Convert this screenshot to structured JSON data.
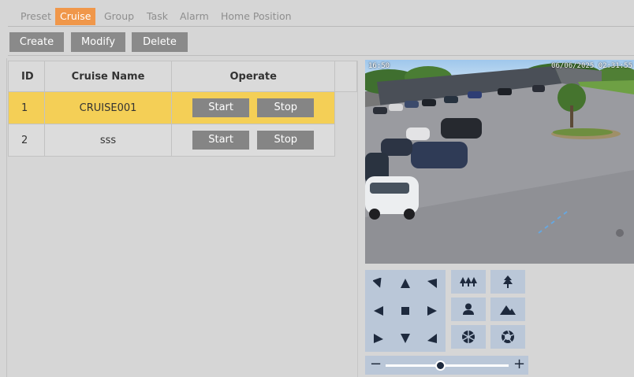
{
  "tabs": [
    {
      "label": "Preset",
      "active": false
    },
    {
      "label": "Cruise",
      "active": true
    },
    {
      "label": "Group",
      "active": false
    },
    {
      "label": "Task",
      "active": false
    },
    {
      "label": "Alarm",
      "active": false
    },
    {
      "label": "Home Position",
      "active": false
    }
  ],
  "toolbar": {
    "create_label": "Create",
    "modify_label": "Modify",
    "delete_label": "Delete"
  },
  "table": {
    "headers": [
      "ID",
      "Cruise Name",
      "Operate"
    ],
    "rows": [
      {
        "id": "1",
        "name": "CRUISE001",
        "start": "Start",
        "stop": "Stop",
        "selected": true
      },
      {
        "id": "2",
        "name": "sss",
        "start": "Start",
        "stop": "Stop",
        "selected": false
      }
    ]
  },
  "video": {
    "osd_left": "16:50",
    "osd_right": "06/06/2025 02:31:55"
  },
  "ptz": {
    "directions": [
      "up-left-icon",
      "up-icon",
      "up-right-icon",
      "left-icon",
      "stop-icon",
      "right-icon",
      "down-left-icon",
      "down-icon",
      "down-right-icon"
    ],
    "lens": [
      "zoom-out-trees-icon",
      "zoom-in-tree-icon",
      "focus-near-icon",
      "focus-far-icon",
      "iris-close-icon",
      "iris-open-icon"
    ],
    "zoom_speed_fraction": 0.42
  },
  "colors": {
    "accent": "#f0974a",
    "selected_row": "#f4cf56",
    "button": "#8a8a8a",
    "ptz_bg": "#bac7d8"
  }
}
